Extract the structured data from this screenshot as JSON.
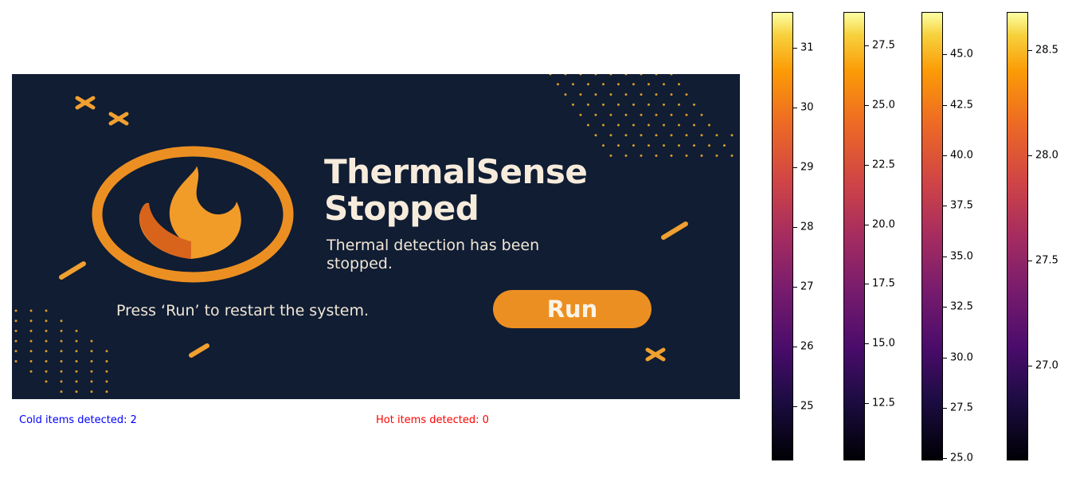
{
  "banner": {
    "title_line1": "ThermalSense",
    "title_line2": "Stopped",
    "subtitle": "Thermal detection has been stopped.",
    "prompt": "Press ‘Run’ to restart the system.",
    "run_label": "Run",
    "logo_icon": "flame-icon",
    "colors": {
      "background": "#101d33",
      "accent": "#ec8f22",
      "text": "#f7ecdc"
    }
  },
  "status": {
    "cold": "Cold items detected: 2",
    "hot": "Hot items detected: 0",
    "cold_color": "#0000ff",
    "hot_color": "#ff0000"
  },
  "colorbars": [
    {
      "colormap": "inferno",
      "min": 24.1,
      "max": 31.6,
      "ticks": [
        "25",
        "26",
        "27",
        "28",
        "29",
        "30",
        "31"
      ],
      "tick_values": [
        25,
        26,
        27,
        28,
        29,
        30,
        31
      ]
    },
    {
      "colormap": "inferno",
      "min": 10.1,
      "max": 28.9,
      "ticks": [
        "12.5",
        "15.0",
        "17.5",
        "20.0",
        "22.5",
        "25.0",
        "27.5"
      ],
      "tick_values": [
        12.5,
        15.0,
        17.5,
        20.0,
        22.5,
        25.0,
        27.5
      ]
    },
    {
      "colormap": "inferno",
      "min": 24.9,
      "max": 47.1,
      "ticks": [
        "25.0",
        "27.5",
        "30.0",
        "32.5",
        "35.0",
        "37.5",
        "40.0",
        "42.5",
        "45.0"
      ],
      "tick_values": [
        25.0,
        27.5,
        30.0,
        32.5,
        35.0,
        37.5,
        40.0,
        42.5,
        45.0
      ]
    },
    {
      "colormap": "inferno",
      "min": 26.55,
      "max": 28.68,
      "ticks": [
        "27.0",
        "27.5",
        "28.0",
        "28.5"
      ],
      "tick_values": [
        27.0,
        27.5,
        28.0,
        28.5
      ]
    }
  ]
}
